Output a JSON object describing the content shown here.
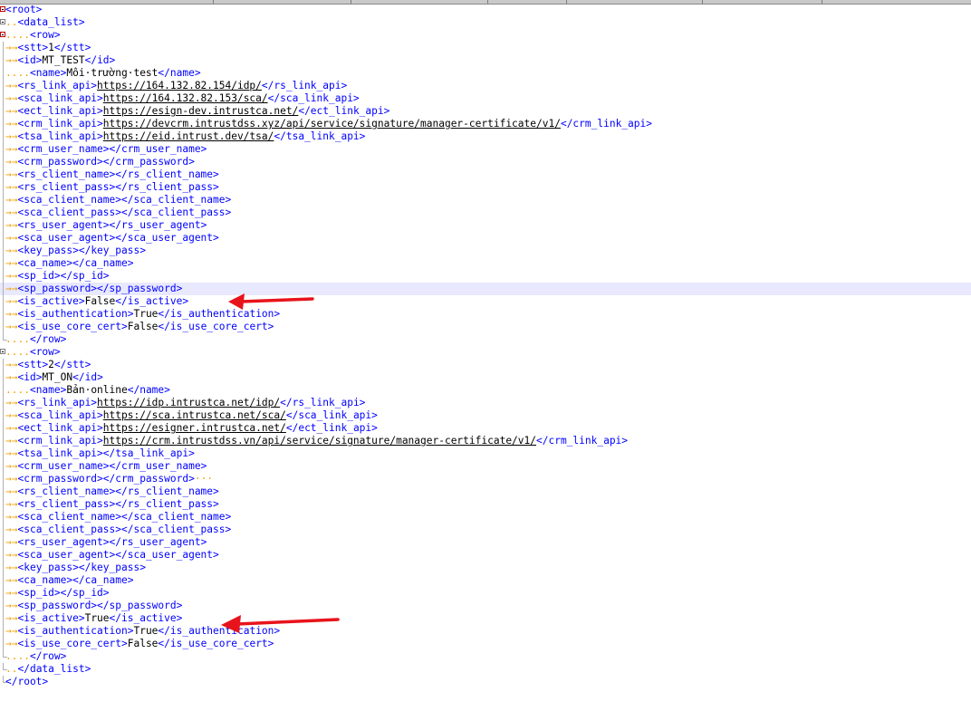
{
  "lines": [
    {
      "indent": "",
      "text": "<root>",
      "kind": "tag",
      "fold": "box-red"
    },
    {
      "indent": "..",
      "text": "<data_list>",
      "kind": "tag",
      "fold": "box"
    },
    {
      "indent": "....",
      "text": "<row>",
      "kind": "tag",
      "fold": "box-red"
    },
    {
      "indent": "→→",
      "tag_open": "<stt>",
      "value": "1",
      "tag_close": "</stt>"
    },
    {
      "indent": "→→",
      "tag_open": "<id>",
      "value": "MT_TEST",
      "tag_close": "</id>"
    },
    {
      "indent": "....",
      "tag_open": "<name>",
      "value": "Môi·trường·test",
      "tag_close": "</name>"
    },
    {
      "indent": "→→",
      "tag_open": "<rs_link_api>",
      "value": "https://164.132.82.154/idp/",
      "url": true,
      "tag_close": "</rs_link_api>"
    },
    {
      "indent": "→→",
      "tag_open": "<sca_link_api>",
      "value": "https://164.132.82.153/sca/",
      "url": true,
      "tag_close": "</sca_link_api>"
    },
    {
      "indent": "→→",
      "tag_open": "<ect_link_api>",
      "value": "https://esign-dev.intrustca.net/",
      "url": true,
      "tag_close": "</ect_link_api>"
    },
    {
      "indent": "→→",
      "tag_open": "<crm_link_api>",
      "value": "https://devcrm.intrustdss.xyz/api/service/signature/manager-certificate/v1/",
      "url": true,
      "tag_close": "</crm_link_api>"
    },
    {
      "indent": "→→",
      "tag_open": "<tsa_link_api>",
      "value": "https://eid.intrust.dev/tsa/",
      "url": true,
      "tag_close": "</tsa_link_api>"
    },
    {
      "indent": "→→",
      "tag_open": "<crm_user_name>",
      "value": "",
      "tag_close": "</crm_user_name>"
    },
    {
      "indent": "→→",
      "tag_open": "<crm_password>",
      "value": "",
      "tag_close": "</crm_password>"
    },
    {
      "indent": "→→",
      "tag_open": "<rs_client_name>",
      "value": "",
      "tag_close": "</rs_client_name>"
    },
    {
      "indent": "→→",
      "tag_open": "<rs_client_pass>",
      "value": "",
      "tag_close": "</rs_client_pass>"
    },
    {
      "indent": "→→",
      "tag_open": "<sca_client_name>",
      "value": "",
      "tag_close": "</sca_client_name>"
    },
    {
      "indent": "→→",
      "tag_open": "<sca_client_pass>",
      "value": "",
      "tag_close": "</sca_client_pass>"
    },
    {
      "indent": "→→",
      "tag_open": "<rs_user_agent>",
      "value": "",
      "tag_close": "</rs_user_agent>"
    },
    {
      "indent": "→→",
      "tag_open": "<sca_user_agent>",
      "value": "",
      "tag_close": "</sca_user_agent>"
    },
    {
      "indent": "→→",
      "tag_open": "<key_pass>",
      "value": "",
      "tag_close": "</key_pass>"
    },
    {
      "indent": "→→",
      "tag_open": "<ca_name>",
      "value": "",
      "tag_close": "</ca_name>"
    },
    {
      "indent": "→→",
      "tag_open": "<sp_id>",
      "value": "",
      "tag_close": "</sp_id>"
    },
    {
      "indent": "→→",
      "tag_open": "<sp_password>",
      "value": "",
      "tag_close": "</sp_password>",
      "highlight": true
    },
    {
      "indent": "→→",
      "tag_open": "<is_active>",
      "value": "False",
      "tag_close": "</is_active>"
    },
    {
      "indent": "→→",
      "tag_open": "<is_authentication>",
      "value": "True",
      "tag_close": "</is_authentication>"
    },
    {
      "indent": "→→",
      "tag_open": "<is_use_core_cert>",
      "value": "False",
      "tag_close": "</is_use_core_cert>"
    },
    {
      "indent": "....",
      "text": "</row>",
      "kind": "tag",
      "fold": "end"
    },
    {
      "indent": "....",
      "text": "<row>",
      "kind": "tag",
      "fold": "box"
    },
    {
      "indent": "→→",
      "tag_open": "<stt>",
      "value": "2",
      "tag_close": "</stt>"
    },
    {
      "indent": "→→",
      "tag_open": "<id>",
      "value": "MT_ON",
      "tag_close": "</id>"
    },
    {
      "indent": "....",
      "tag_open": "<name>",
      "value": "Bản·online",
      "tag_close": "</name>"
    },
    {
      "indent": "→→",
      "tag_open": "<rs_link_api>",
      "value": "https://idp.intrustca.net/idp/",
      "url": true,
      "tag_close": "</rs_link_api>"
    },
    {
      "indent": "→→",
      "tag_open": "<sca_link_api>",
      "value": "https://sca.intrustca.net/sca/",
      "url": true,
      "tag_close": "</sca_link_api>"
    },
    {
      "indent": "→→",
      "tag_open": "<ect_link_api>",
      "value": "https://esigner.intrustca.net/",
      "url": true,
      "tag_close": "</ect_link_api>"
    },
    {
      "indent": "→→",
      "tag_open": "<crm_link_api>",
      "value": "https://crm.intrustdss.vn/api/service/signature/manager-certificate/v1/",
      "url": true,
      "tag_close": "</crm_link_api>"
    },
    {
      "indent": "→→",
      "tag_open": "<tsa_link_api>",
      "value": "",
      "tag_close": "</tsa_link_api>"
    },
    {
      "indent": "→→",
      "tag_open": "<crm_user_name>",
      "value": "",
      "tag_close": "</crm_user_name>"
    },
    {
      "indent": "→→",
      "tag_open": "<crm_password>",
      "value": "",
      "tag_close": "</crm_password>",
      "trail": "···"
    },
    {
      "indent": "→→",
      "tag_open": "<rs_client_name>",
      "value": "",
      "tag_close": "</rs_client_name>"
    },
    {
      "indent": "→→",
      "tag_open": "<rs_client_pass>",
      "value": "",
      "tag_close": "</rs_client_pass>"
    },
    {
      "indent": "→→",
      "tag_open": "<sca_client_name>",
      "value": "",
      "tag_close": "</sca_client_name>"
    },
    {
      "indent": "→→",
      "tag_open": "<sca_client_pass>",
      "value": "",
      "tag_close": "</sca_client_pass>"
    },
    {
      "indent": "→→",
      "tag_open": "<rs_user_agent>",
      "value": "",
      "tag_close": "</rs_user_agent>"
    },
    {
      "indent": "→→",
      "tag_open": "<sca_user_agent>",
      "value": "",
      "tag_close": "</sca_user_agent>"
    },
    {
      "indent": "→→",
      "tag_open": "<key_pass>",
      "value": "",
      "tag_close": "</key_pass>"
    },
    {
      "indent": "→→",
      "tag_open": "<ca_name>",
      "value": "",
      "tag_close": "</ca_name>"
    },
    {
      "indent": "→→",
      "tag_open": "<sp_id>",
      "value": "",
      "tag_close": "</sp_id>"
    },
    {
      "indent": "→→",
      "tag_open": "<sp_password>",
      "value": "",
      "tag_close": "</sp_password>"
    },
    {
      "indent": "→→",
      "tag_open": "<is_active>",
      "value": "True",
      "tag_close": "</is_active>"
    },
    {
      "indent": "→→",
      "tag_open": "<is_authentication>",
      "value": "True",
      "tag_close": "</is_authentication>"
    },
    {
      "indent": "→→",
      "tag_open": "<is_use_core_cert>",
      "value": "False",
      "tag_close": "</is_use_core_cert>"
    },
    {
      "indent": "....",
      "text": "</row>",
      "kind": "tag",
      "fold": "end"
    },
    {
      "indent": "..",
      "text": "</data_list>",
      "kind": "tag",
      "fold": "end"
    },
    {
      "indent": "",
      "text": "</root>",
      "kind": "tag",
      "fold": "end"
    }
  ],
  "annotation_color": "#e8141b",
  "colors": {
    "tag": "#0000ff",
    "whitespace": "#f0a000",
    "line_highlight": "#e8e8ff"
  }
}
